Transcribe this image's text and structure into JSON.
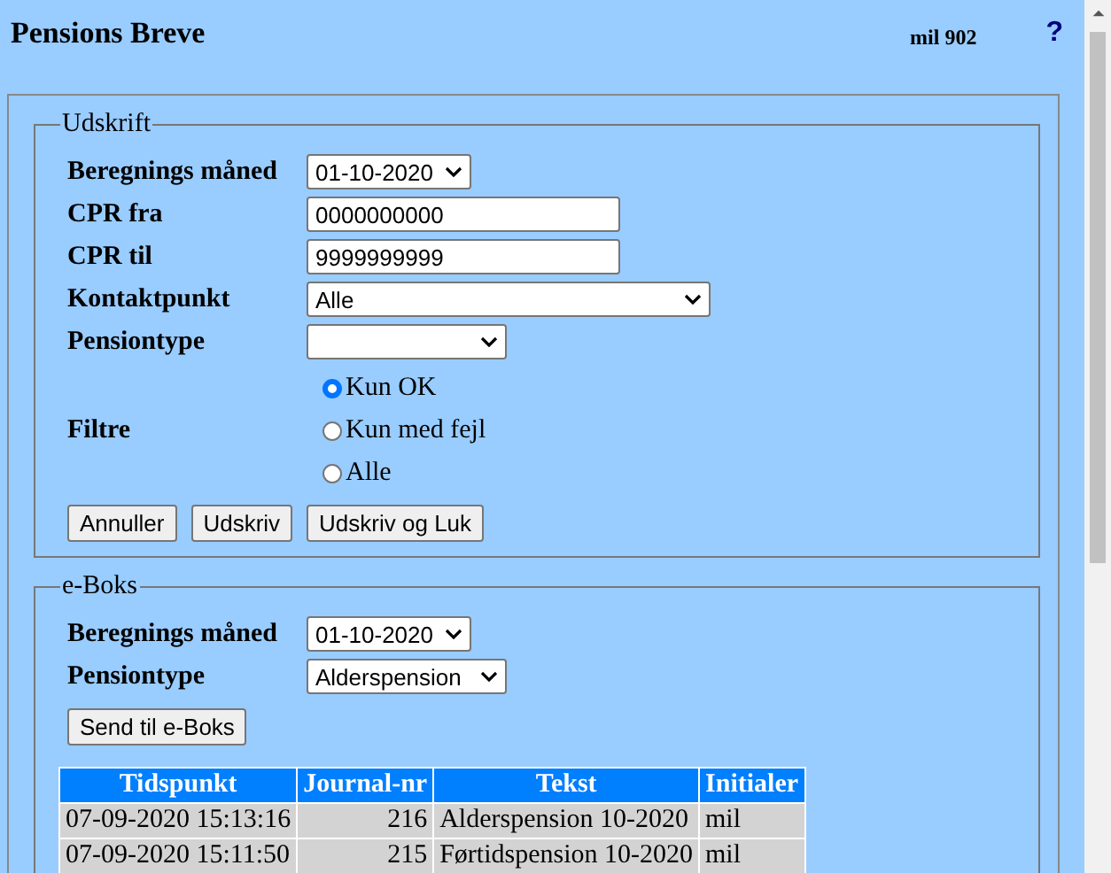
{
  "header": {
    "title": "Pensions Breve",
    "user": "mil 902",
    "help": "?"
  },
  "udskrift": {
    "legend": "Udskrift",
    "fields": [
      {
        "kind": "select",
        "label": "Beregnings måned",
        "value": "01-10-2020"
      },
      {
        "kind": "text",
        "label": "CPR fra",
        "value": "0000000000"
      },
      {
        "kind": "text",
        "label": "CPR til",
        "value": "9999999999"
      },
      {
        "kind": "select",
        "label": "Kontaktpunkt",
        "value": "Alle"
      },
      {
        "kind": "select",
        "label": "Pensiontype"
      }
    ],
    "filter": {
      "label": "Filtre",
      "options": [
        {
          "label": "Kun OK",
          "selected": true
        },
        {
          "label": "Kun med fejl",
          "selected": false
        },
        {
          "label": "Alle",
          "selected": false
        }
      ]
    },
    "buttons": [
      "Annuller",
      "Udskriv",
      "Udskriv og Luk"
    ]
  },
  "eboks": {
    "legend": "e-Boks",
    "fields": [
      {
        "kind": "select",
        "label": "Beregnings måned",
        "value": "01-10-2020"
      },
      {
        "kind": "select",
        "label": "Pensiontype",
        "value": "Alderspension"
      }
    ],
    "button": "Send til e-Boks",
    "table": {
      "columns": [
        "Tidspunkt",
        "Journal-nr",
        "Tekst",
        "Initialer"
      ],
      "rows": [
        [
          "07-09-2020 15:13:16",
          "216",
          "Alderspension 10-2020",
          "mil"
        ],
        [
          "07-09-2020 15:11:50",
          "215",
          "Førtidspension 10-2020",
          "mil"
        ]
      ]
    }
  }
}
